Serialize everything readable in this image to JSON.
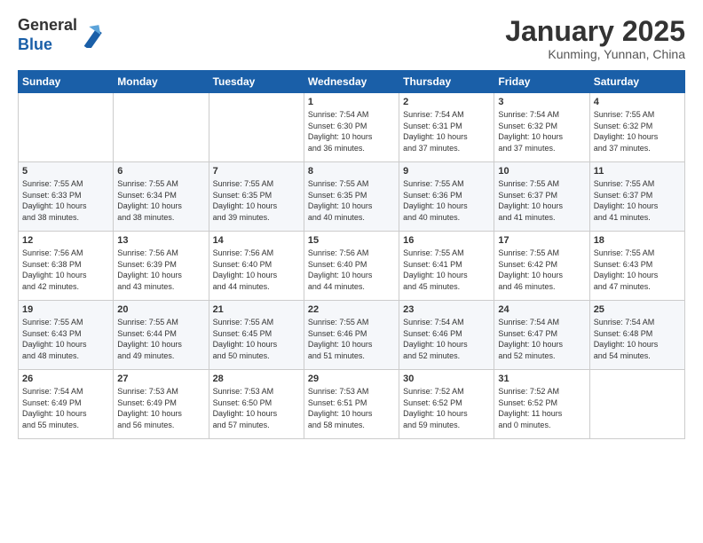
{
  "header": {
    "logo_line1": "General",
    "logo_line2": "Blue",
    "month_title": "January 2025",
    "location": "Kunming, Yunnan, China"
  },
  "days_of_week": [
    "Sunday",
    "Monday",
    "Tuesday",
    "Wednesday",
    "Thursday",
    "Friday",
    "Saturday"
  ],
  "weeks": [
    [
      {
        "num": "",
        "info": ""
      },
      {
        "num": "",
        "info": ""
      },
      {
        "num": "",
        "info": ""
      },
      {
        "num": "1",
        "info": "Sunrise: 7:54 AM\nSunset: 6:30 PM\nDaylight: 10 hours\nand 36 minutes."
      },
      {
        "num": "2",
        "info": "Sunrise: 7:54 AM\nSunset: 6:31 PM\nDaylight: 10 hours\nand 37 minutes."
      },
      {
        "num": "3",
        "info": "Sunrise: 7:54 AM\nSunset: 6:32 PM\nDaylight: 10 hours\nand 37 minutes."
      },
      {
        "num": "4",
        "info": "Sunrise: 7:55 AM\nSunset: 6:32 PM\nDaylight: 10 hours\nand 37 minutes."
      }
    ],
    [
      {
        "num": "5",
        "info": "Sunrise: 7:55 AM\nSunset: 6:33 PM\nDaylight: 10 hours\nand 38 minutes."
      },
      {
        "num": "6",
        "info": "Sunrise: 7:55 AM\nSunset: 6:34 PM\nDaylight: 10 hours\nand 38 minutes."
      },
      {
        "num": "7",
        "info": "Sunrise: 7:55 AM\nSunset: 6:35 PM\nDaylight: 10 hours\nand 39 minutes."
      },
      {
        "num": "8",
        "info": "Sunrise: 7:55 AM\nSunset: 6:35 PM\nDaylight: 10 hours\nand 40 minutes."
      },
      {
        "num": "9",
        "info": "Sunrise: 7:55 AM\nSunset: 6:36 PM\nDaylight: 10 hours\nand 40 minutes."
      },
      {
        "num": "10",
        "info": "Sunrise: 7:55 AM\nSunset: 6:37 PM\nDaylight: 10 hours\nand 41 minutes."
      },
      {
        "num": "11",
        "info": "Sunrise: 7:55 AM\nSunset: 6:37 PM\nDaylight: 10 hours\nand 41 minutes."
      }
    ],
    [
      {
        "num": "12",
        "info": "Sunrise: 7:56 AM\nSunset: 6:38 PM\nDaylight: 10 hours\nand 42 minutes."
      },
      {
        "num": "13",
        "info": "Sunrise: 7:56 AM\nSunset: 6:39 PM\nDaylight: 10 hours\nand 43 minutes."
      },
      {
        "num": "14",
        "info": "Sunrise: 7:56 AM\nSunset: 6:40 PM\nDaylight: 10 hours\nand 44 minutes."
      },
      {
        "num": "15",
        "info": "Sunrise: 7:56 AM\nSunset: 6:40 PM\nDaylight: 10 hours\nand 44 minutes."
      },
      {
        "num": "16",
        "info": "Sunrise: 7:55 AM\nSunset: 6:41 PM\nDaylight: 10 hours\nand 45 minutes."
      },
      {
        "num": "17",
        "info": "Sunrise: 7:55 AM\nSunset: 6:42 PM\nDaylight: 10 hours\nand 46 minutes."
      },
      {
        "num": "18",
        "info": "Sunrise: 7:55 AM\nSunset: 6:43 PM\nDaylight: 10 hours\nand 47 minutes."
      }
    ],
    [
      {
        "num": "19",
        "info": "Sunrise: 7:55 AM\nSunset: 6:43 PM\nDaylight: 10 hours\nand 48 minutes."
      },
      {
        "num": "20",
        "info": "Sunrise: 7:55 AM\nSunset: 6:44 PM\nDaylight: 10 hours\nand 49 minutes."
      },
      {
        "num": "21",
        "info": "Sunrise: 7:55 AM\nSunset: 6:45 PM\nDaylight: 10 hours\nand 50 minutes."
      },
      {
        "num": "22",
        "info": "Sunrise: 7:55 AM\nSunset: 6:46 PM\nDaylight: 10 hours\nand 51 minutes."
      },
      {
        "num": "23",
        "info": "Sunrise: 7:54 AM\nSunset: 6:46 PM\nDaylight: 10 hours\nand 52 minutes."
      },
      {
        "num": "24",
        "info": "Sunrise: 7:54 AM\nSunset: 6:47 PM\nDaylight: 10 hours\nand 52 minutes."
      },
      {
        "num": "25",
        "info": "Sunrise: 7:54 AM\nSunset: 6:48 PM\nDaylight: 10 hours\nand 54 minutes."
      }
    ],
    [
      {
        "num": "26",
        "info": "Sunrise: 7:54 AM\nSunset: 6:49 PM\nDaylight: 10 hours\nand 55 minutes."
      },
      {
        "num": "27",
        "info": "Sunrise: 7:53 AM\nSunset: 6:49 PM\nDaylight: 10 hours\nand 56 minutes."
      },
      {
        "num": "28",
        "info": "Sunrise: 7:53 AM\nSunset: 6:50 PM\nDaylight: 10 hours\nand 57 minutes."
      },
      {
        "num": "29",
        "info": "Sunrise: 7:53 AM\nSunset: 6:51 PM\nDaylight: 10 hours\nand 58 minutes."
      },
      {
        "num": "30",
        "info": "Sunrise: 7:52 AM\nSunset: 6:52 PM\nDaylight: 10 hours\nand 59 minutes."
      },
      {
        "num": "31",
        "info": "Sunrise: 7:52 AM\nSunset: 6:52 PM\nDaylight: 11 hours\nand 0 minutes."
      },
      {
        "num": "",
        "info": ""
      }
    ]
  ]
}
